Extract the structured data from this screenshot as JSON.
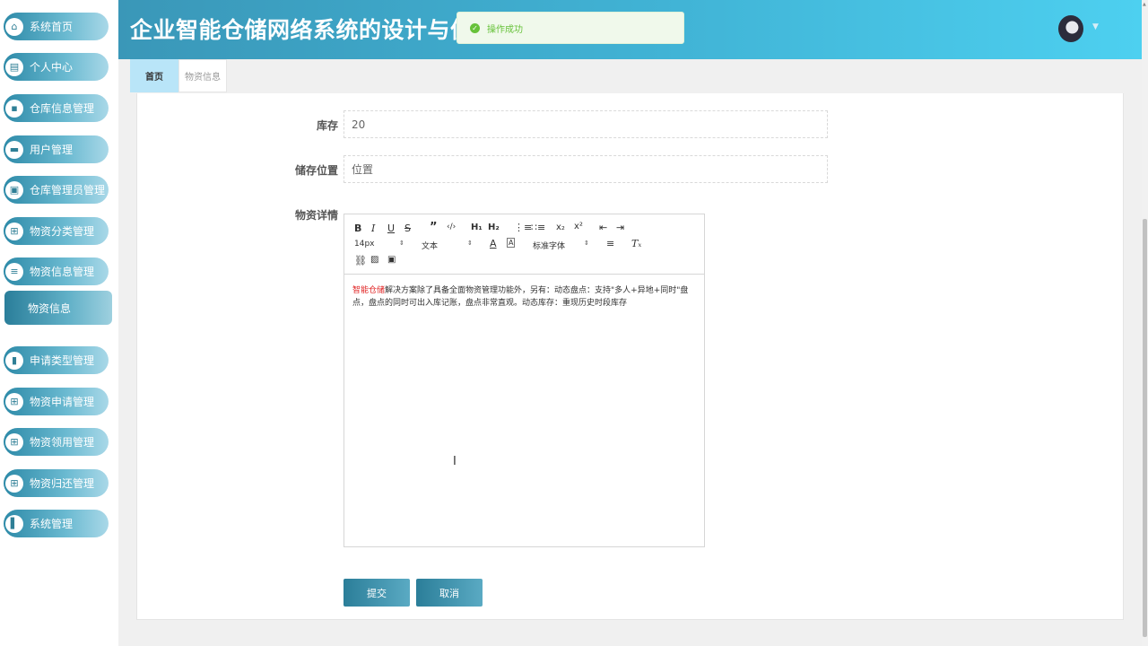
{
  "app": {
    "title": "企业智能仓储网络系统的设计与仿"
  },
  "toast": {
    "message": "操作成功"
  },
  "sidebar": {
    "items": [
      {
        "label": "系统首页",
        "icon": "home-icon"
      },
      {
        "label": "个人中心",
        "icon": "profile-icon"
      },
      {
        "label": "仓库信息管理",
        "icon": "warehouse-icon"
      },
      {
        "label": "用户管理",
        "icon": "monitor-icon"
      },
      {
        "label": "仓库管理员管理",
        "icon": "briefcase-icon"
      },
      {
        "label": "物资分类管理",
        "icon": "grid-icon"
      },
      {
        "label": "物资信息管理",
        "icon": "sliders-icon"
      },
      {
        "label": "物资信息",
        "icon": ""
      },
      {
        "label": "申请类型管理",
        "icon": "bar-chart-icon"
      },
      {
        "label": "物资申请管理",
        "icon": "grid-icon"
      },
      {
        "label": "物资领用管理",
        "icon": "grid-icon"
      },
      {
        "label": "物资归还管理",
        "icon": "grid-icon"
      },
      {
        "label": "系统管理",
        "icon": "book-icon"
      }
    ]
  },
  "tabs": [
    {
      "label": "首页"
    },
    {
      "label": "物资信息"
    }
  ],
  "form": {
    "stock_label": "库存",
    "stock_value": "20",
    "location_label": "储存位置",
    "location_value": "位置",
    "detail_label": "物资详情"
  },
  "editor": {
    "font_size": "14px",
    "block_type": "文本",
    "font_family": "标准字体",
    "content_brand": "智能仓储",
    "content_text": "解决方案除了具备全面物资管理功能外，另有：动态盘点：支持\"多人+异地+同时\"盘点，盘点的同时可出入库记账，盘点非常直观。动态库存：重现历史时段库存"
  },
  "buttons": {
    "submit": "提交",
    "cancel": "取消"
  }
}
